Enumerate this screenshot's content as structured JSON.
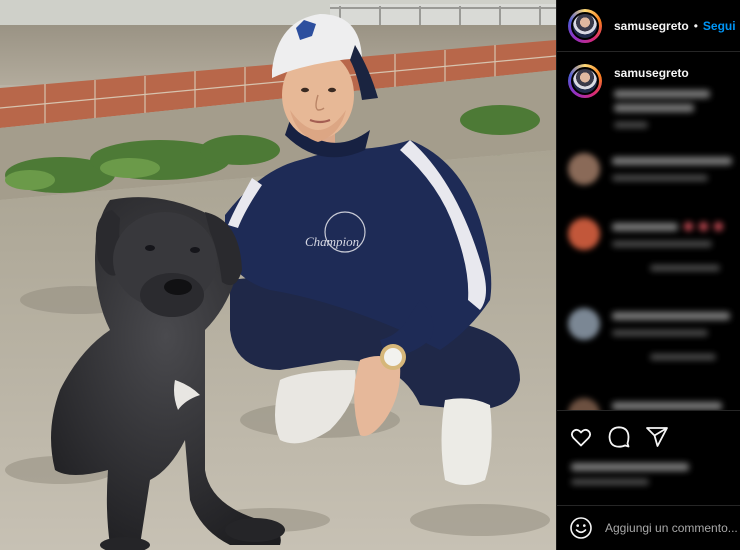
{
  "post": {
    "username": "samusegreto",
    "follow_label": "Segui",
    "separator": "•"
  },
  "comment_box": {
    "placeholder": "Aggiungi un commento..."
  },
  "icons": {
    "like": "heart-icon",
    "comment": "comment-icon",
    "share": "paper-plane-icon",
    "emoji": "smiley-icon"
  },
  "colors": {
    "accent": "#0095f6",
    "background": "#000000",
    "text": "#f5f5f5",
    "divider": "#262626"
  }
}
